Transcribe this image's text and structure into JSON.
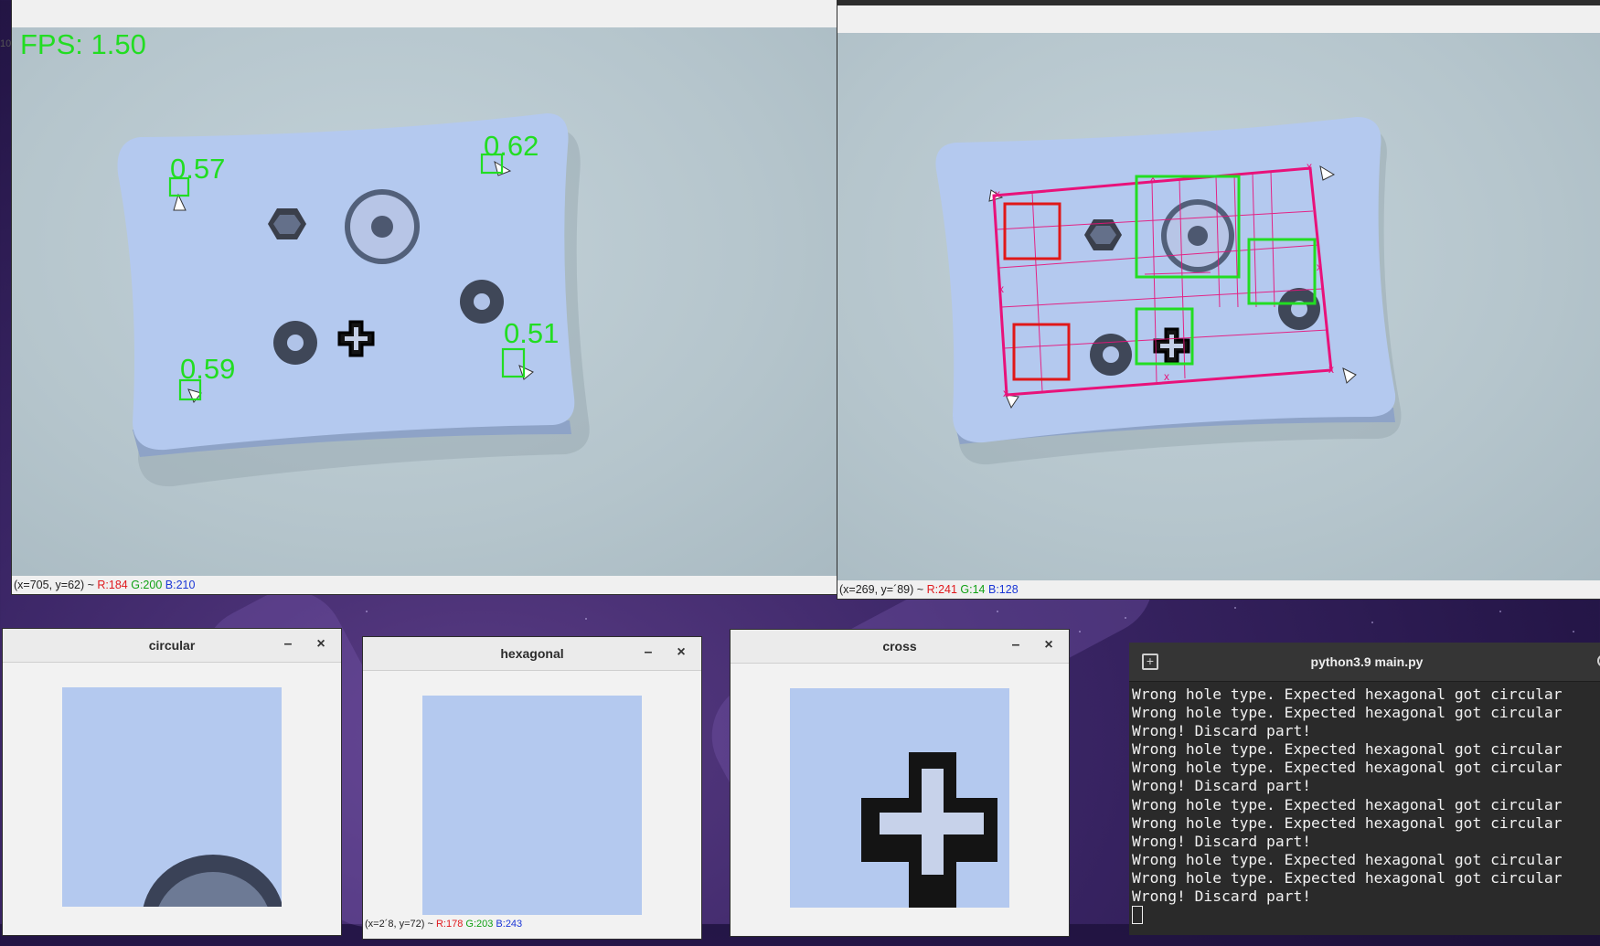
{
  "left_viewer": {
    "fps_label": "FPS: 1.50",
    "corner_scores": [
      "0.57",
      "0.62",
      "0.59",
      "0.51"
    ],
    "status": {
      "coords": "(x=705, y=62) ~",
      "r": "R:184",
      "g": "G:200",
      "b": "B:210"
    },
    "edge_text": "10"
  },
  "right_viewer": {
    "status": {
      "coords": "(x=269, y=´89) ~",
      "r": "R:241",
      "g": "G:14",
      "b": "B:128"
    }
  },
  "windows": {
    "circular": {
      "title": "circular",
      "minimize": "–",
      "close": "×"
    },
    "hexagonal": {
      "title": "hexagonal",
      "minimize": "–",
      "close": "×",
      "status": {
        "coords": "(x=2´8, y=72) ~",
        "r": "R:178",
        "g": "G:203",
        "b": "B:243"
      }
    },
    "cross": {
      "title": "cross",
      "minimize": "–",
      "close": "×"
    }
  },
  "terminal": {
    "title": "python3.9 main.py",
    "lines": [
      "Wrong hole type. Expected hexagonal got circular",
      "Wrong hole type. Expected hexagonal got circular",
      "Wrong! Discard part!",
      "Wrong hole type. Expected hexagonal got circular",
      "Wrong hole type. Expected hexagonal got circular",
      "Wrong! Discard part!",
      "Wrong hole type. Expected hexagonal got circular",
      "Wrong hole type. Expected hexagonal got circular",
      "Wrong! Discard part!",
      "Wrong hole type. Expected hexagonal got circular",
      "Wrong hole type. Expected hexagonal got circular",
      "Wrong! Discard part!"
    ]
  },
  "colors": {
    "detection_green": "#22dd22",
    "mismatch_red": "#e01818",
    "homography_magenta": "#e8127a",
    "part_blue": "#b4c9ef",
    "background_gray": "#b7c7cf",
    "terminal_bg": "#2a2a2a"
  },
  "icons": {
    "terminal_new_tab": "plus-tab-icon",
    "terminal_search": "search-icon",
    "window_minimize": "minimize-icon",
    "window_close": "close-icon"
  }
}
